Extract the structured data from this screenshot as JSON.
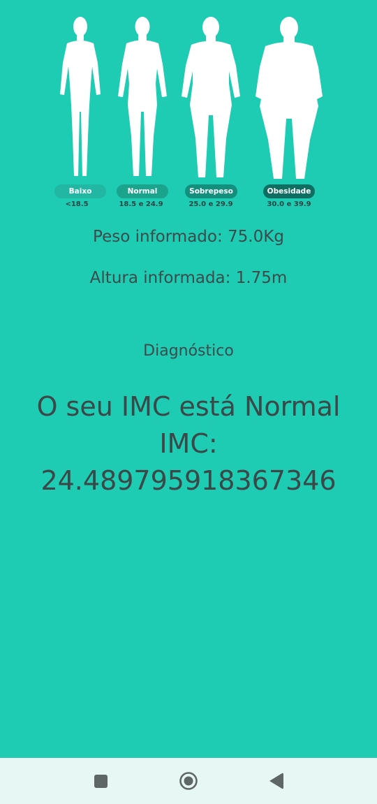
{
  "categories": [
    {
      "label": "Baixo",
      "range": "<18.5",
      "color": "#22b7a2"
    },
    {
      "label": "Normal",
      "range": "18.5 e 24.9",
      "color": "#1aa48e"
    },
    {
      "label": "Sobrepeso",
      "range": "25.0 e 29.9",
      "color": "#138f7d"
    },
    {
      "label": "Obesidade",
      "range": "30.0 e 39.9",
      "color": "#0d6e61"
    }
  ],
  "info": {
    "peso": "Peso informado: 75.0Kg",
    "altura": "Altura informada: 1.75m"
  },
  "diagnostico": {
    "title": "Diagnóstico",
    "line1": "O seu IMC está Normal",
    "line2": "IMC:",
    "line3": "24.489795918367346"
  },
  "colors": {
    "background": "#1ecbb3",
    "navbar": "#e6f7f4",
    "text": "#3d4b4b"
  },
  "navbar": {
    "icons": [
      "recent-apps-icon",
      "home-icon",
      "back-icon"
    ]
  }
}
